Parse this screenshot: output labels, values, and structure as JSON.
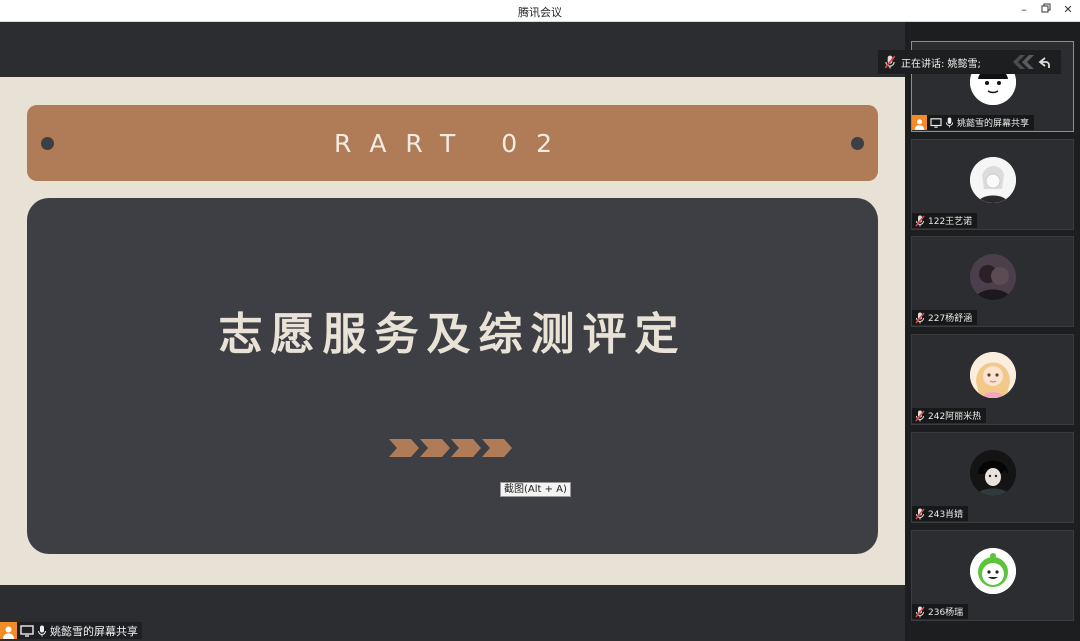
{
  "window": {
    "title": "腾讯会议"
  },
  "slide": {
    "banner_text": "RART 02",
    "headline": "志愿服务及综测评定"
  },
  "tooltip": "截图(Alt + A)",
  "bottom_share_label": "姚懿雪的屏幕共享",
  "speaking": {
    "label": "正在讲话: 姚懿雪;"
  },
  "participants": [
    {
      "name": "姚懿雪的屏幕共享",
      "active": true
    },
    {
      "name": "122王艺诺"
    },
    {
      "name": "227杨舒涵"
    },
    {
      "name": "242阿丽米热"
    },
    {
      "name": "243肖婧"
    },
    {
      "name": "236杨瑞"
    }
  ],
  "colors": {
    "accent": "#f28c28",
    "active_border": "#3dbb7c",
    "banner": "#b07c58",
    "card": "#3e3f44"
  }
}
